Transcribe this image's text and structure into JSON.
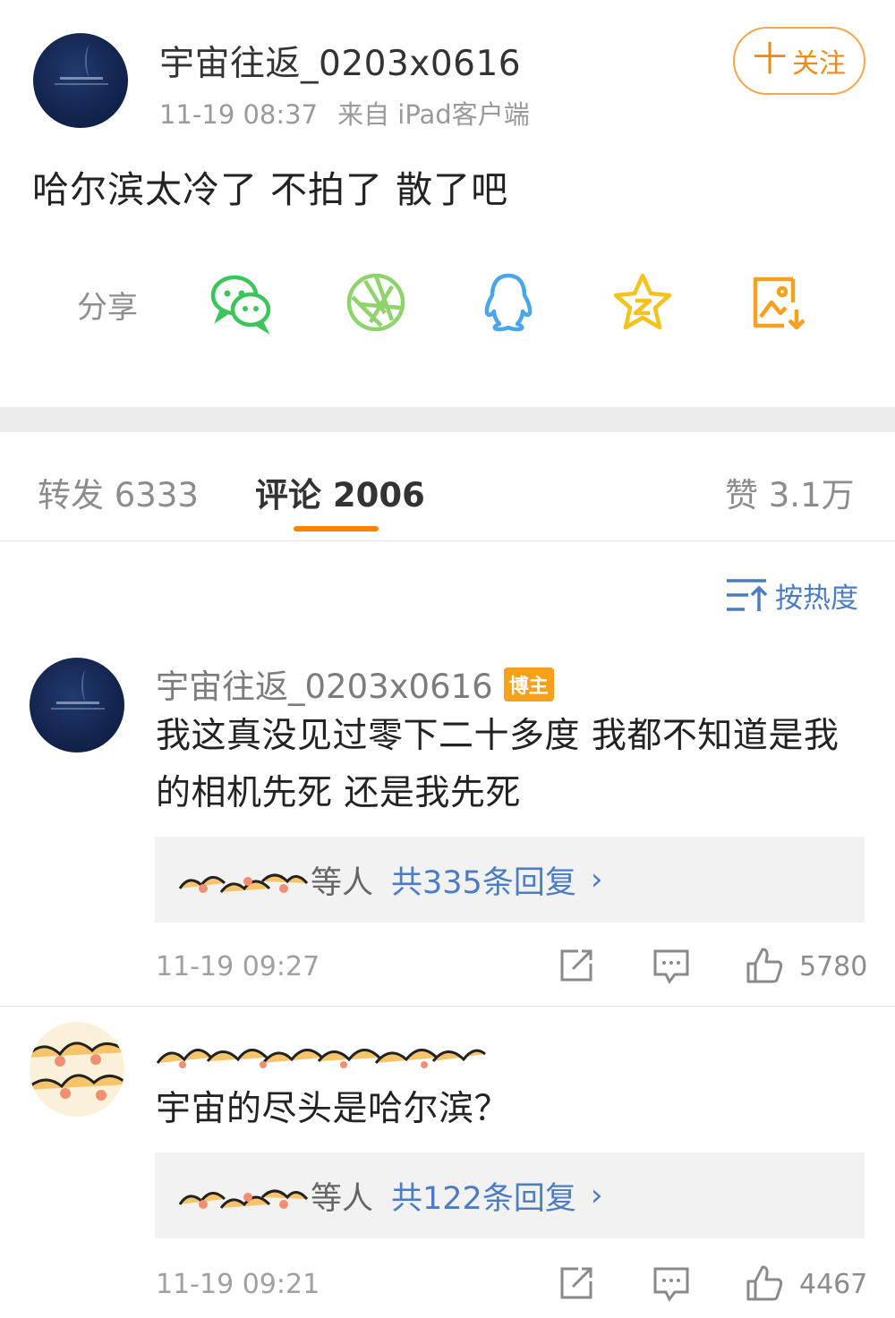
{
  "post": {
    "author": "宇宙往返_0203x0616",
    "time": "11-19 08:37",
    "source": "来自 iPad客户端",
    "follow_label": "关注",
    "follow_plus": "十",
    "text": "哈尔滨太冷了 不拍了 散了吧"
  },
  "share": {
    "label": "分享",
    "targets": [
      "wechat-icon",
      "moments-icon",
      "qq-icon",
      "qzone-icon",
      "save-image-icon"
    ]
  },
  "tabs": [
    {
      "label": "转发 6333"
    },
    {
      "label": "评论 2006"
    },
    {
      "label": "赞 3.1万"
    }
  ],
  "sort": {
    "label": "按热度"
  },
  "comments": [
    {
      "author": "宇宙往返_0203x0616",
      "badge": "博主",
      "text": "我这真没见过零下二十多度 我都不知道是我的相机先死 还是我先死",
      "reply_who": "等人",
      "reply_count": "共335条回复",
      "reply_arrow": "›",
      "time": "11-19 09:27",
      "likes": "5780"
    },
    {
      "author": "",
      "text": "宇宙的尽头是哈尔滨？",
      "reply_who": "等人",
      "reply_count": "共122条回复",
      "reply_arrow": "›",
      "time": "11-19 09:21",
      "likes": "4467"
    }
  ],
  "colors": {
    "accent_orange": "#ff8200",
    "link_blue": "#4b7cc4",
    "wechat_green": "#3cc55a",
    "moments_green": "#8ed36b",
    "qq_blue": "#4aa6e8",
    "qzone_yellow": "#f5c21b",
    "save_orange": "#f5a11c"
  }
}
